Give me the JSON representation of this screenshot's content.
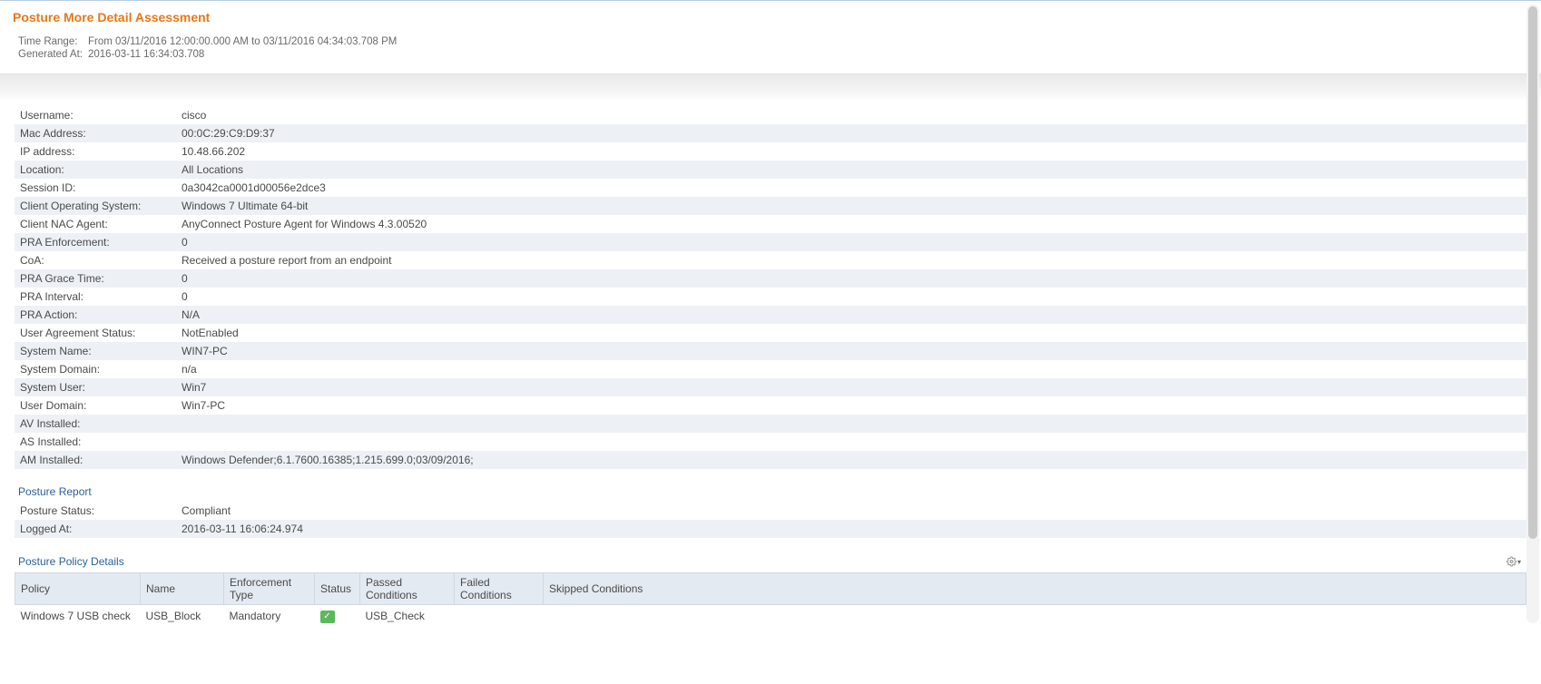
{
  "title": "Posture More Detail Assessment",
  "meta": {
    "timeRangeLabel": "Time Range:",
    "timeRangeValue": "From 03/11/2016 12:00:00.000 AM to 03/11/2016 04:34:03.708 PM",
    "generatedAtLabel": "Generated At:",
    "generatedAtValue": "2016-03-11 16:34:03.708"
  },
  "details": [
    {
      "label": "Username:",
      "value": "cisco"
    },
    {
      "label": "Mac Address:",
      "value": "00:0C:29:C9:D9:37"
    },
    {
      "label": "IP address:",
      "value": "10.48.66.202"
    },
    {
      "label": "Location:",
      "value": "All Locations"
    },
    {
      "label": "Session ID:",
      "value": "0a3042ca0001d00056e2dce3"
    },
    {
      "label": "Client Operating System:",
      "value": "Windows 7 Ultimate 64-bit"
    },
    {
      "label": "Client NAC Agent:",
      "value": "AnyConnect Posture Agent for Windows 4.3.00520"
    },
    {
      "label": "PRA Enforcement:",
      "value": "0"
    },
    {
      "label": "CoA:",
      "value": "Received a posture report from an endpoint"
    },
    {
      "label": "PRA Grace Time:",
      "value": "0"
    },
    {
      "label": "PRA Interval:",
      "value": "0"
    },
    {
      "label": "PRA Action:",
      "value": "N/A"
    },
    {
      "label": "User Agreement Status:",
      "value": "NotEnabled"
    },
    {
      "label": "System Name:",
      "value": "WIN7-PC"
    },
    {
      "label": "System Domain:",
      "value": "n/a"
    },
    {
      "label": "System User:",
      "value": "Win7"
    },
    {
      "label": "User Domain:",
      "value": "Win7-PC"
    },
    {
      "label": "AV Installed:",
      "value": ""
    },
    {
      "label": "AS Installed:",
      "value": ""
    },
    {
      "label": "AM Installed:",
      "value": "Windows Defender;6.1.7600.16385;1.215.699.0;03/09/2016;"
    }
  ],
  "postureReport": {
    "heading": "Posture Report",
    "rows": [
      {
        "label": "Posture Status:",
        "value": "Compliant"
      },
      {
        "label": "Logged At:",
        "value": "2016-03-11 16:06:24.974"
      }
    ]
  },
  "policyDetails": {
    "heading": "Posture Policy Details",
    "columns": [
      "Policy",
      "Name",
      "Enforcement Type",
      "Status",
      "Passed Conditions",
      "Failed Conditions",
      "Skipped Conditions"
    ],
    "rows": [
      {
        "policy": "Windows 7 USB check",
        "name": "USB_Block",
        "enforcement": "Mandatory",
        "statusIcon": "ok",
        "passed": "USB_Check",
        "failed": "",
        "skipped": ""
      }
    ]
  }
}
